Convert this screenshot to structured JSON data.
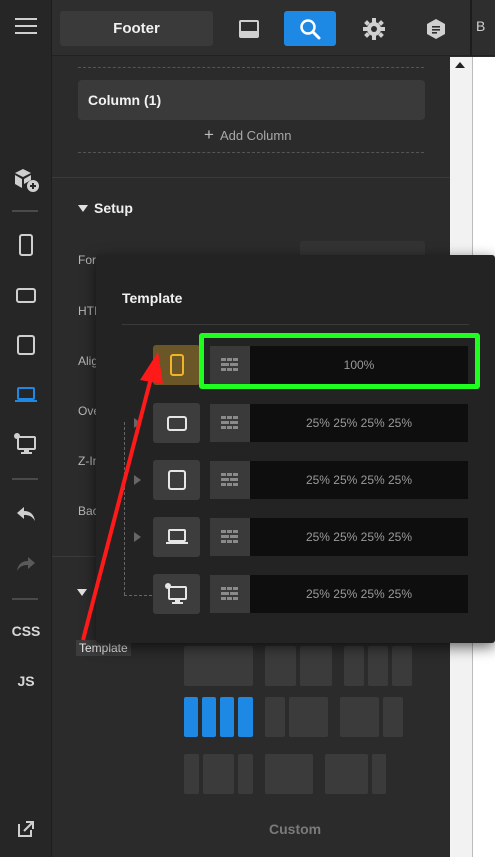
{
  "topbar": {
    "footer_tab": "Footer",
    "edge_text": "B"
  },
  "rail": {
    "css_label": "CSS",
    "js_label": "JS"
  },
  "panel": {
    "column_label": "Column (1)",
    "add_column": "Add Column",
    "setup_label": "Setup",
    "props": [
      "For",
      "HTI",
      "Alig",
      "Ove",
      "Z-In",
      "Bac"
    ],
    "template_label": "Template",
    "custom_label": "Custom"
  },
  "popup": {
    "title": "Template",
    "rows": [
      {
        "device": "mobile-portrait",
        "value": "100%",
        "selected": true
      },
      {
        "device": "mobile-landscape",
        "value": "25% 25% 25% 25%",
        "selected": false
      },
      {
        "device": "tablet",
        "value": "25% 25% 25% 25%",
        "selected": false
      },
      {
        "device": "laptop",
        "value": "25% 25% 25% 25%",
        "selected": false
      },
      {
        "device": "desktop",
        "value": "25% 25% 25% 25%",
        "selected": false
      }
    ]
  },
  "colors": {
    "accent": "#1e88e5",
    "highlight": "#1fff1f",
    "arrow": "#ff1a1a",
    "selected_device": "#f0b429"
  }
}
